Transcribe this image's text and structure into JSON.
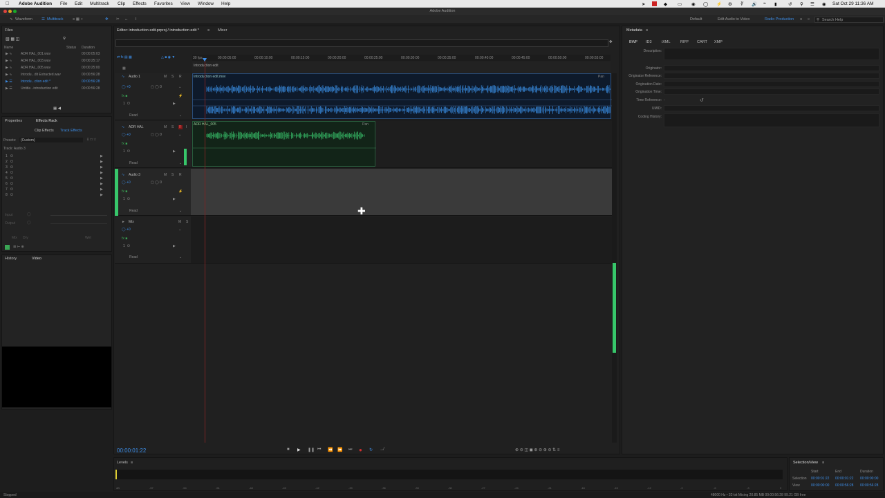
{
  "menubar": {
    "app_name": "Adobe Audition",
    "menus": [
      "File",
      "Edit",
      "Multitrack",
      "Clip",
      "Effects",
      "Favorites",
      "View",
      "Window",
      "Help"
    ],
    "clock": "Sat Oct 29  11:36 AM"
  },
  "window_title": "Adobe Audition",
  "toolbar": {
    "waveform_label": "Waveform",
    "multitrack_label": "Multitrack",
    "workspaces": [
      "Default",
      "Edit Audio to Video",
      "Radio Production"
    ],
    "search_placeholder": "Search Help"
  },
  "files_panel": {
    "title": "Files",
    "col_name": "Name",
    "col_status": "Status",
    "col_duration": "Duration",
    "items": [
      {
        "name": "ADR HAL_001.wav",
        "duration": "00:00:05:03"
      },
      {
        "name": "ADR HAL_003.wav",
        "duration": "00:00:25:17"
      },
      {
        "name": "ADR HAL_005.wav",
        "duration": "00:00:25:00"
      },
      {
        "name": "Introdu...dit Extracted.wav",
        "duration": "00:00:56:28"
      },
      {
        "name": "Introdu...ction edit *",
        "duration": "00:00:56:28",
        "active": true
      },
      {
        "name": "Untitle...introduction edit",
        "duration": "00:00:56:28"
      }
    ]
  },
  "effects_panel": {
    "tab_properties": "Properties",
    "tab_effects_rack": "Effects Rack",
    "tab_clip_effects": "Clip Effects",
    "tab_track_effects": "Track Effects",
    "presets_label": "Presets:",
    "presets_value": "(Custom)",
    "track_label": "Track: Audio 3",
    "slots": [
      "1",
      "2",
      "3",
      "4",
      "5",
      "6",
      "7",
      "8"
    ],
    "input_label": "Input",
    "output_label": "Output",
    "mix_label": "Mix",
    "dry_label": "Dry",
    "wet_label": "Wet"
  },
  "history_panel": {
    "tab_history": "History",
    "tab_video": "Video"
  },
  "editor": {
    "tab_editor": "Editor: introduction edit.prproj / introduction edit *",
    "tab_mixer": "Mixer",
    "ruler": [
      "00:00:05:00",
      "00:00:10:00",
      "00:00:15:00",
      "00:00:20:00",
      "00:00:25:00",
      "00:00:30:00",
      "00:00:35:00",
      "00:00:40:00",
      "00:00:45:00",
      "00:00:50:00",
      "00:00:55:00"
    ],
    "ruler_start": "30 fps",
    "range_label": "Introduction edit",
    "tracks": [
      {
        "name": "Audio 1",
        "clip": "Introduction edit.mov",
        "mode": "Read",
        "pan": "Pan"
      },
      {
        "name": "ADR HAL",
        "clip": "ADR HAL_005",
        "mode": "Read",
        "pan": "Pan"
      },
      {
        "name": "Audio 3",
        "clip": "",
        "mode": "Read"
      },
      {
        "name": "Mix",
        "clip": "",
        "mode": "Read"
      }
    ],
    "mute": "M",
    "solo": "S",
    "record": "R",
    "timecode": "00:00:01:22",
    "accent": "#3d8ee8",
    "wave_blue": "#3a8fe6",
    "wave_green": "#38c06a"
  },
  "metadata": {
    "title": "Metadata",
    "tabs": [
      "BWF",
      "ID3",
      "iXML",
      "RIFF",
      "CART",
      "XMP"
    ],
    "fields": [
      "Description:",
      "Originator:",
      "Originator Reference:",
      "Origination Date:",
      "Origination Time:",
      "Time Reference:",
      "UMID:",
      "Coding History:"
    ],
    "time_reference_value": "-"
  },
  "levels": {
    "title": "Levels",
    "ticks": [
      "dB",
      "-57",
      "-54",
      "-51",
      "-48",
      "-45",
      "-42",
      "-39",
      "-36",
      "-33",
      "-30",
      "-27",
      "-24",
      "-21",
      "-18",
      "-15",
      "-12",
      "-9",
      "-6",
      "-3",
      "0"
    ]
  },
  "selection_view": {
    "title": "Selection/View",
    "col_start": "Start",
    "col_end": "End",
    "col_duration": "Duration",
    "row_selection": "Selection",
    "row_view": "View",
    "selection": [
      "00:00:01:22",
      "00:00:01:22",
      "00:00:00:00"
    ],
    "view": [
      "00:00:00:00",
      "00:00:56:28",
      "00:00:56:28"
    ]
  },
  "status": {
    "left": "Stopped",
    "right": "48000 Hz • 32-bit Mixing    20.85 MB    00:00:56:28    99.21 GB free"
  }
}
